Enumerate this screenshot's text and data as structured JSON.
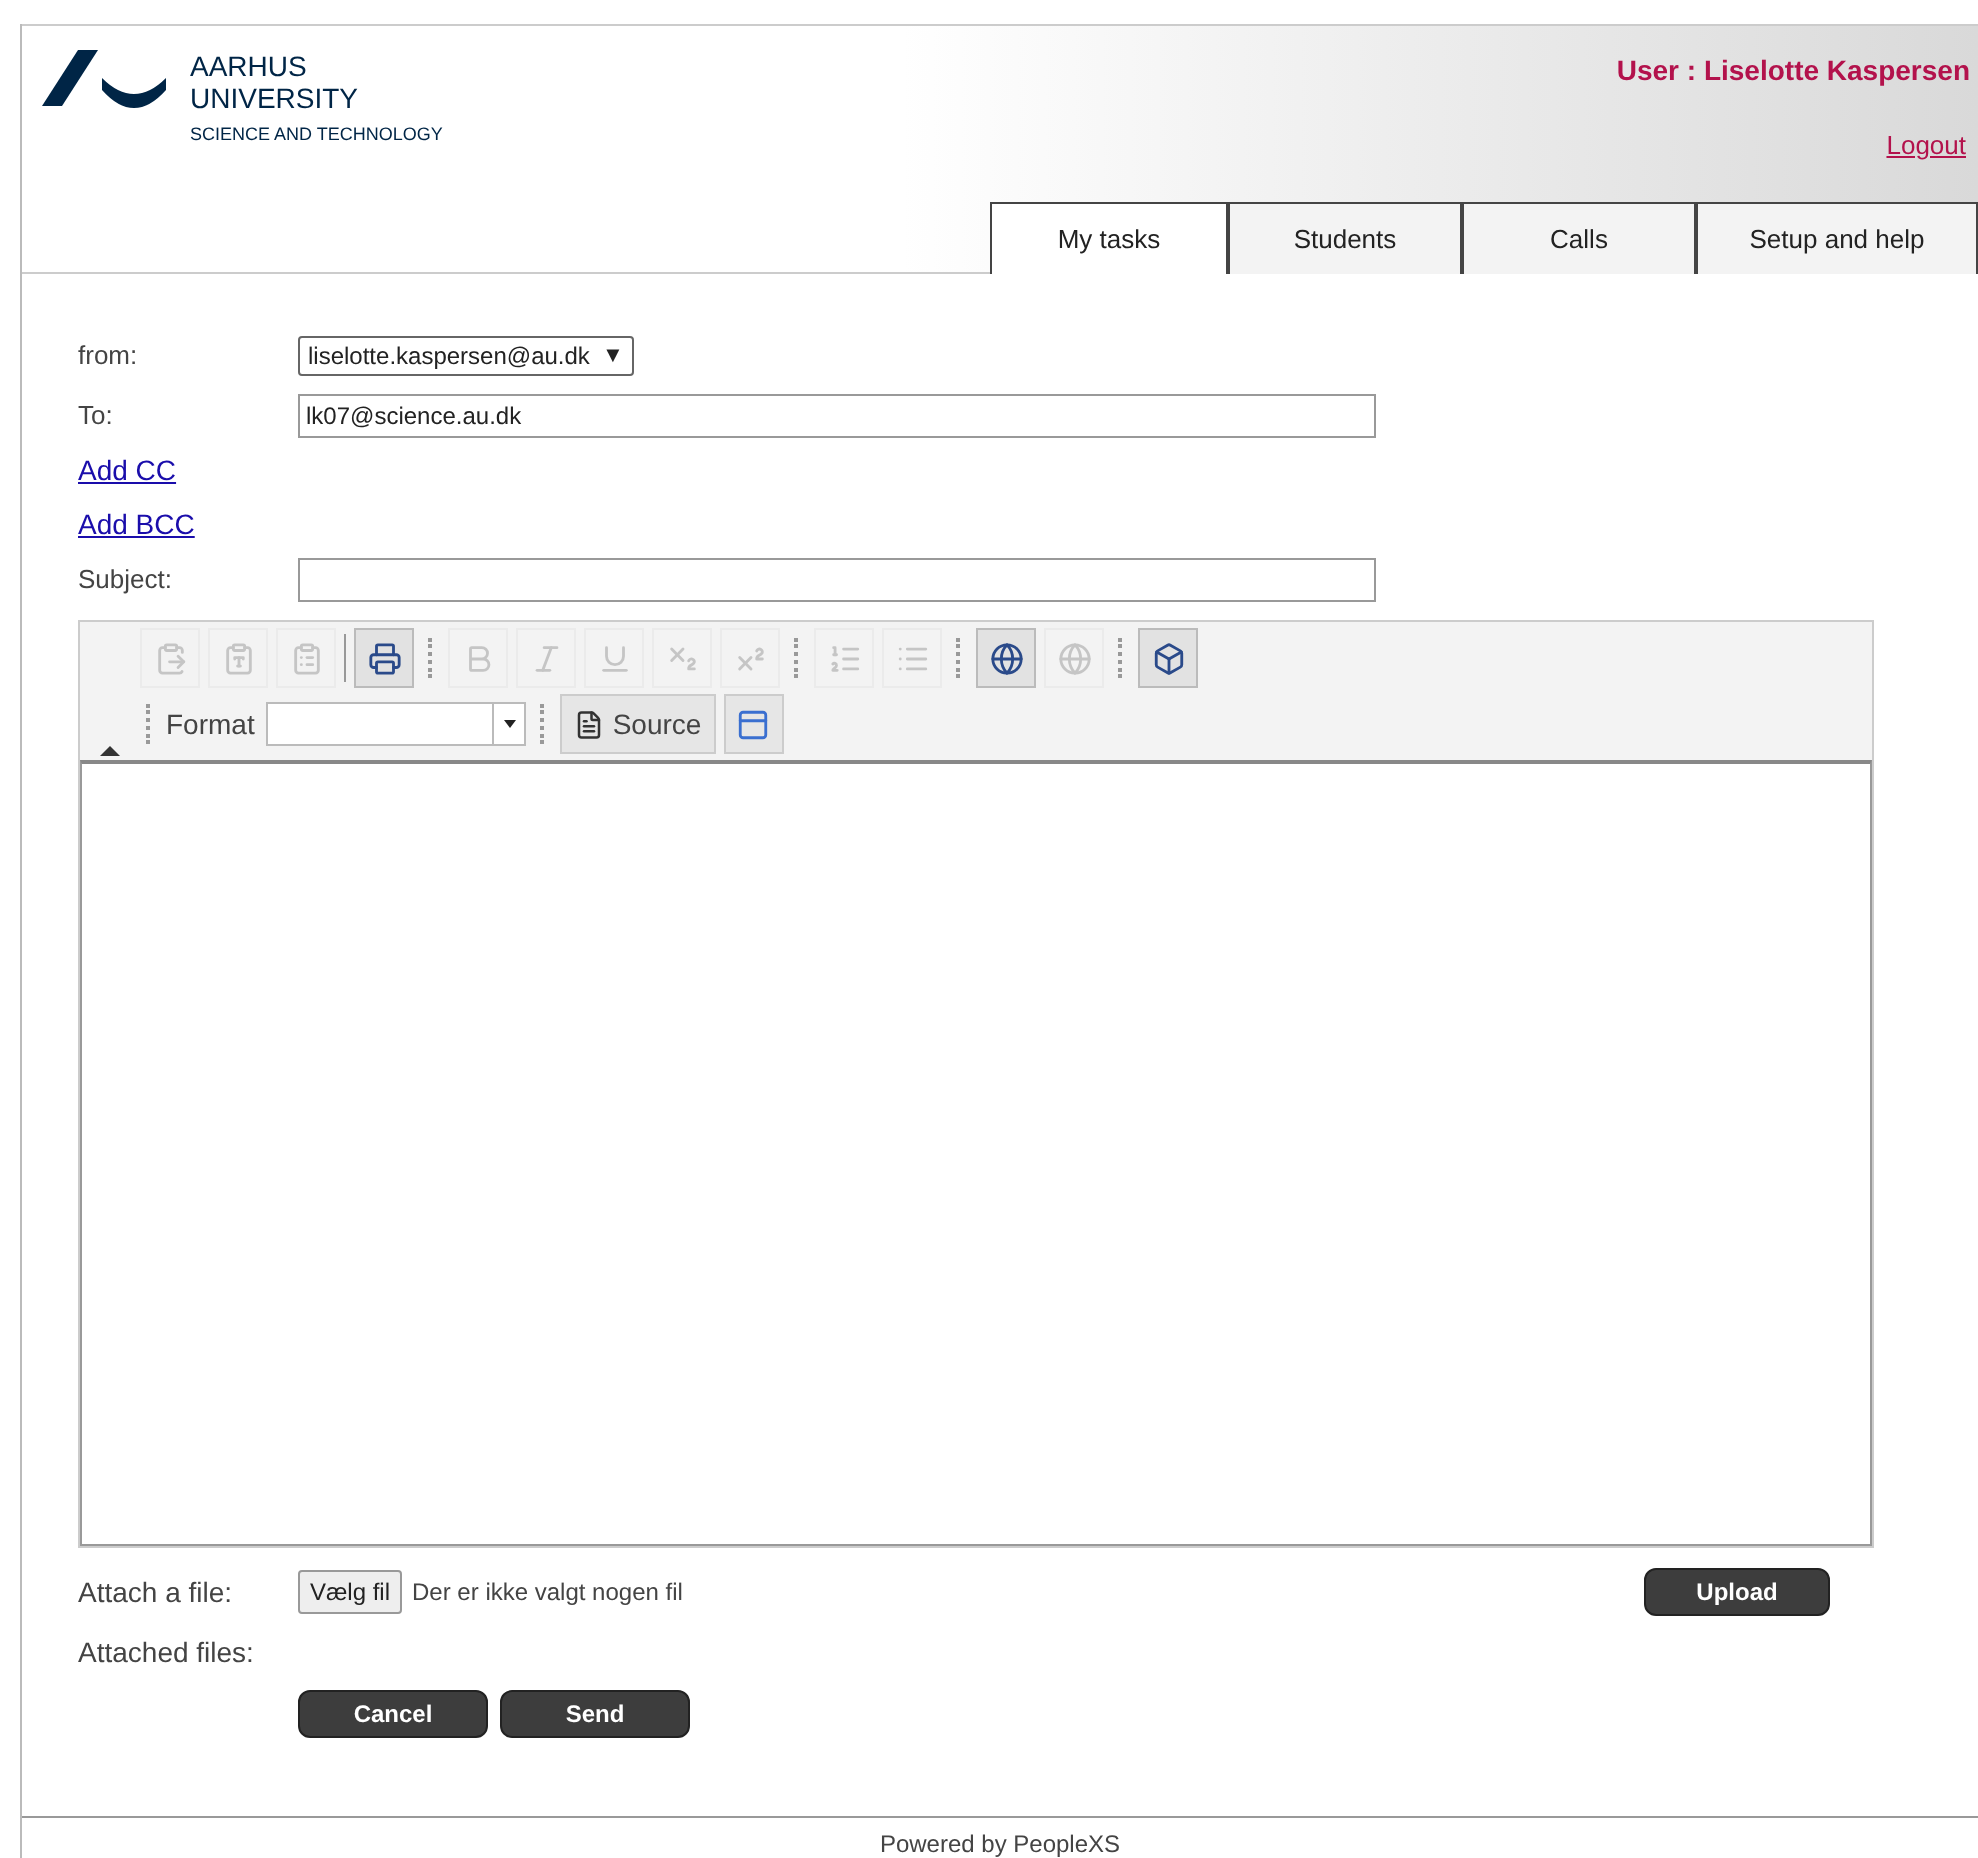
{
  "header": {
    "logo_line_1": "AARHUS",
    "logo_line_2": "UNIVERSITY",
    "logo_line_3": "SCIENCE AND TECHNOLOGY",
    "user": "User : Liselotte Kaspersen",
    "logout": "Logout"
  },
  "tabs": [
    {
      "label": "My tasks",
      "selected": true
    },
    {
      "label": "Students",
      "selected": false
    },
    {
      "label": "Calls",
      "selected": false
    },
    {
      "label": "Setup and help",
      "selected": false
    }
  ],
  "form": {
    "from_label": "from:",
    "from_value": "liselotte.kaspersen@au.dk",
    "from_caret": "▼",
    "to_label": "To:",
    "to_value": "lk07@science.au.dk",
    "add_cc": "Add CC",
    "add_bcc": "Add BCC",
    "subject_label": "Subject:"
  },
  "editor": {
    "toolbar": [
      {
        "kind": "paste",
        "disabled": true
      },
      {
        "kind": "paste-text",
        "disabled": true
      },
      {
        "kind": "paste-word",
        "disabled": true
      },
      {
        "kind": "separator"
      },
      {
        "kind": "print",
        "disabled": false
      },
      {
        "kind": "group"
      },
      {
        "kind": "bold",
        "disabled": true
      },
      {
        "kind": "italic",
        "disabled": true
      },
      {
        "kind": "underline",
        "disabled": true
      },
      {
        "kind": "subscript",
        "disabled": true
      },
      {
        "kind": "superscript",
        "disabled": true
      },
      {
        "kind": "group"
      },
      {
        "kind": "ordered-list",
        "disabled": true
      },
      {
        "kind": "bullet-list",
        "disabled": true
      },
      {
        "kind": "group"
      },
      {
        "kind": "link",
        "disabled": false
      },
      {
        "kind": "unlink",
        "disabled": true
      },
      {
        "kind": "group"
      },
      {
        "kind": "object",
        "disabled": false
      }
    ],
    "format_label": "Format",
    "source_label": "Source"
  },
  "attach": {
    "label": "Attach a file:",
    "choose_button": "Vælg fil",
    "no_file": "Der er ikke valgt nogen fil",
    "upload": "Upload",
    "attached_label": "Attached files:"
  },
  "buttons": [
    {
      "label": "Cancel"
    },
    {
      "label": "Send"
    }
  ],
  "footer": "Powered by PeopleXS"
}
